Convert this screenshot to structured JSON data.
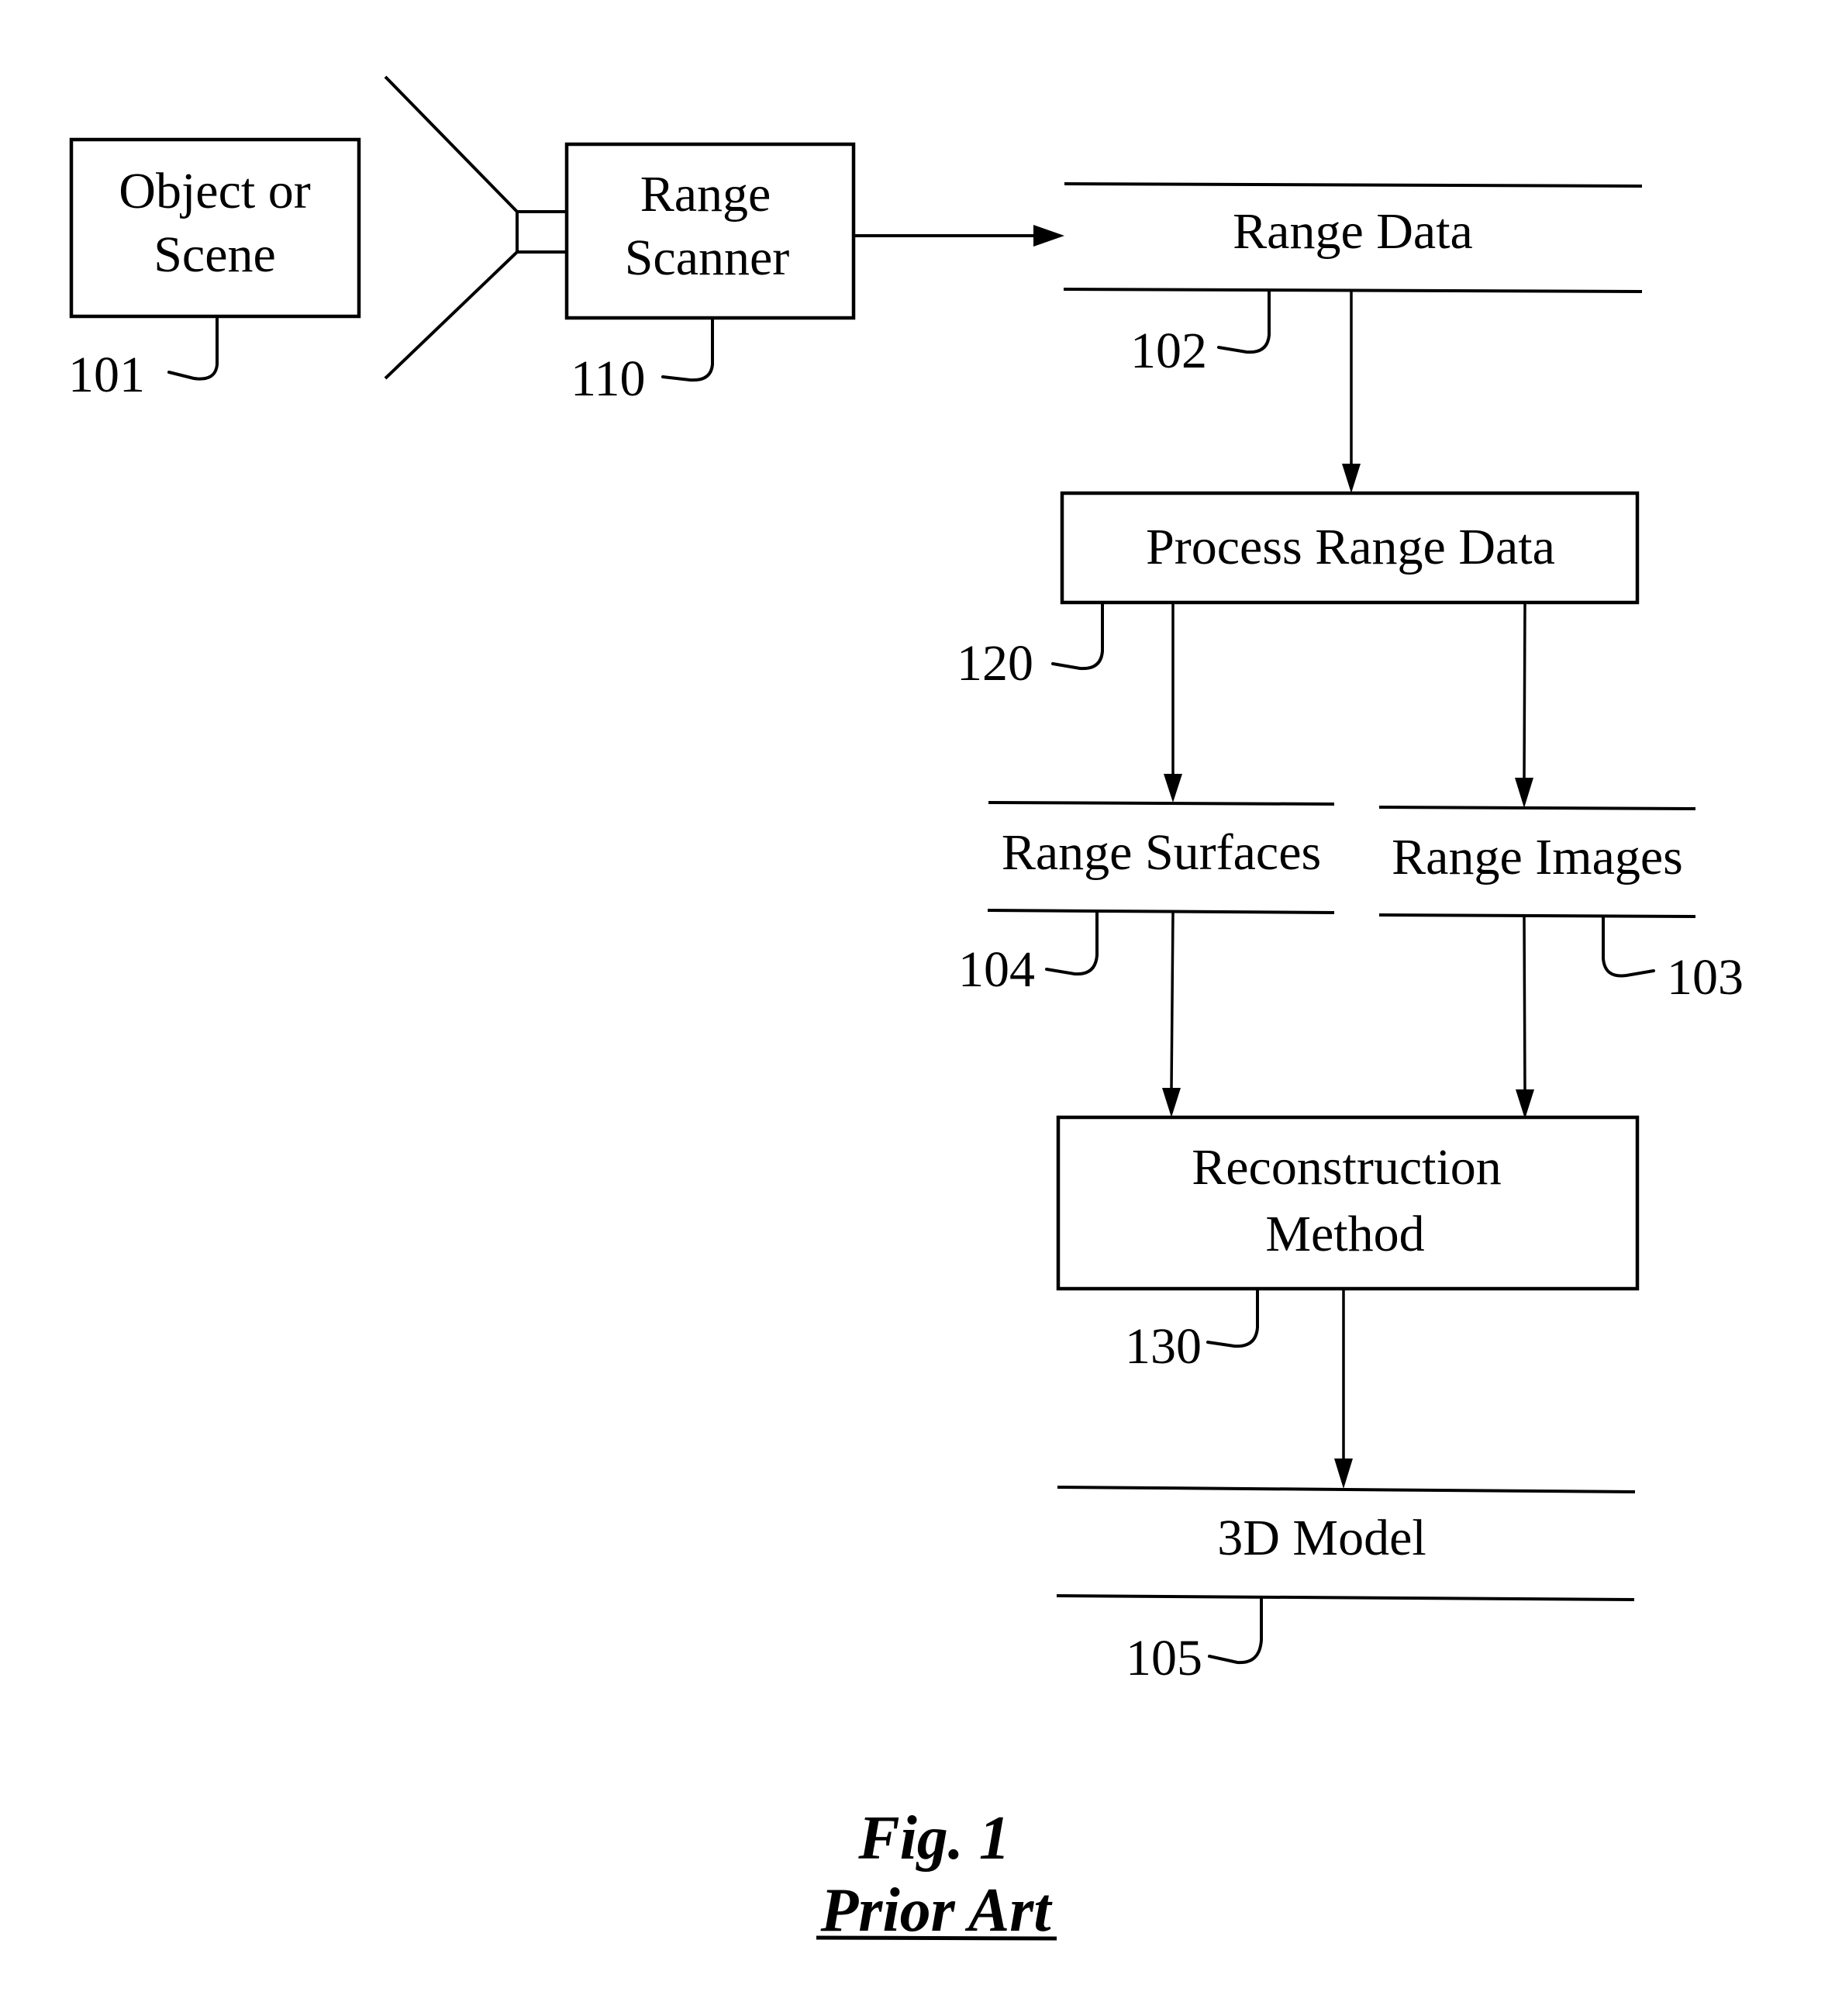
{
  "diagram": {
    "nodes": {
      "object_scene": {
        "line1": "Object or",
        "line2": "Scene",
        "ref": "101"
      },
      "range_scanner": {
        "line1": "Range",
        "line2": "Scanner",
        "ref": "110"
      },
      "range_data": {
        "label": "Range Data",
        "ref": "102"
      },
      "process_range_data": {
        "label": "Process Range Data",
        "ref": "120"
      },
      "range_surfaces": {
        "label": "Range Surfaces",
        "ref": "104"
      },
      "range_images": {
        "label": "Range Images",
        "ref": "103"
      },
      "reconstruction_method": {
        "line1": "Reconstruction",
        "line2": "Method",
        "ref": "130"
      },
      "model_3d": {
        "label": "3D Model",
        "ref": "105"
      }
    },
    "edges": [
      {
        "from": "range_scanner",
        "to": "range_data"
      },
      {
        "from": "range_data",
        "to": "process_range_data"
      },
      {
        "from": "process_range_data",
        "to": "range_surfaces"
      },
      {
        "from": "process_range_data",
        "to": "range_images"
      },
      {
        "from": "range_surfaces",
        "to": "reconstruction_method"
      },
      {
        "from": "range_images",
        "to": "reconstruction_method"
      },
      {
        "from": "reconstruction_method",
        "to": "model_3d"
      }
    ]
  },
  "caption": {
    "figure": "Fig. 1",
    "subtitle": "Prior Art"
  }
}
